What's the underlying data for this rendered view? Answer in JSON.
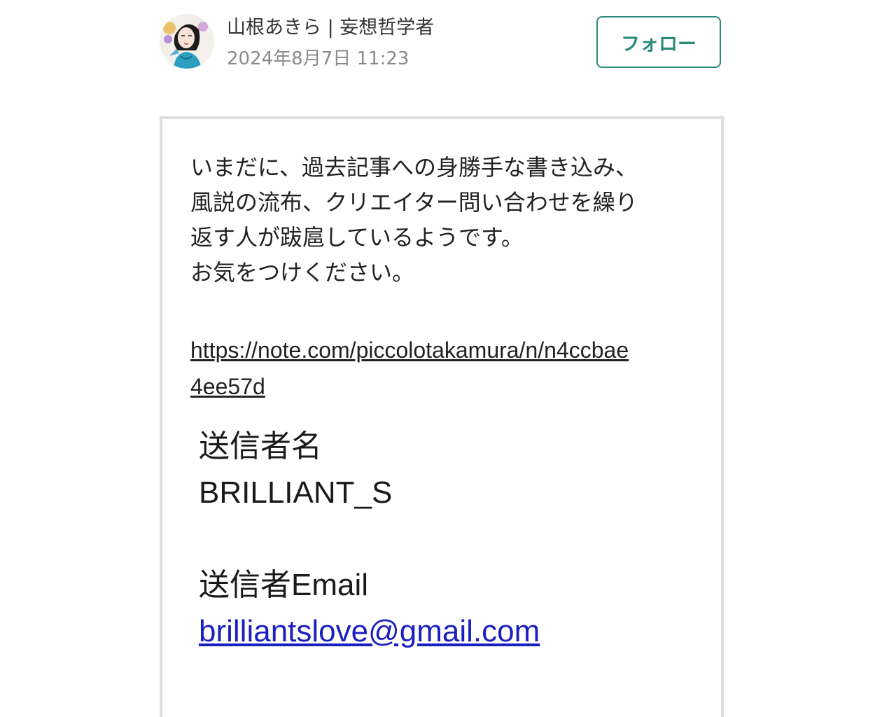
{
  "author": {
    "name": "山根あきら | 妄想哲学者",
    "date": "2024年8月7日 11:23",
    "avatar_icon": "avatar-illustration"
  },
  "follow_button": {
    "label": "フォロー",
    "color": "#2b8a7a"
  },
  "comment": {
    "lines": [
      "いまだに、過去記事への身勝手な書き込み、",
      "風説の流布、クリエイター問い合わせを繰り",
      "返す人が跋扈しているようです。",
      "お気をつけください。"
    ],
    "link_line1": "https://note.com/piccolotakamura/n/n4ccbae",
    "link_line2": "4ee57d"
  },
  "embedded_image": {
    "sender_name_label": "送信者名",
    "sender_name_value": "BRILLIANT_S",
    "sender_email_label": "送信者Email",
    "sender_email_value": "brilliantslove@gmail.com",
    "link_color": "#1a1fbf"
  }
}
